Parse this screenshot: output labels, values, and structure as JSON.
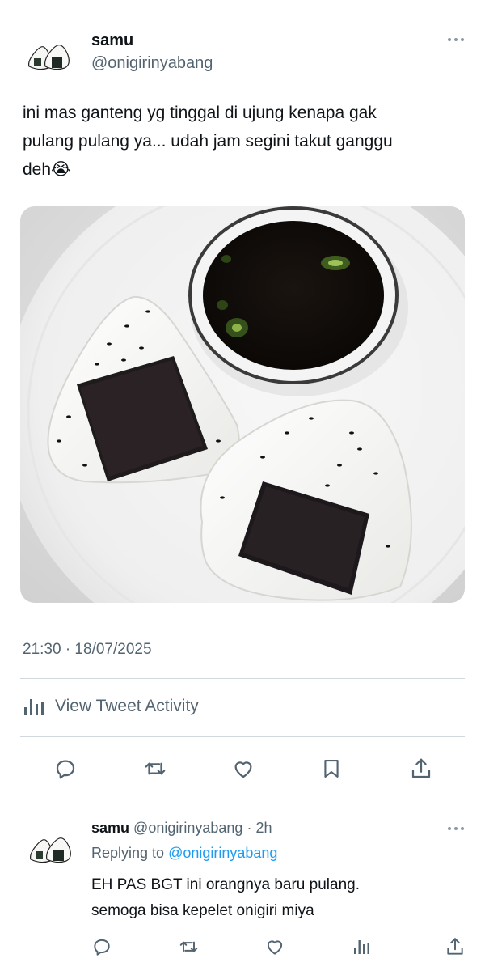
{
  "main_tweet": {
    "display_name": "samu",
    "handle": "@onigirinyabang",
    "text_line1": "ini mas ganteng yg tinggal di ujung kenapa gak",
    "text_line2": "pulang pulang ya... udah jam segini takut ganggu",
    "text_line3": "deh😭",
    "timestamp": "21:30 · 18/07/2025",
    "activity_label": "View Tweet Activity"
  },
  "icons": {
    "avatar": "onigiri-avatar-icon",
    "more": "more-dots-icon",
    "activity": "bar-chart-icon",
    "reply": "comment-bubble-icon",
    "retweet": "retweet-icon",
    "like": "heart-icon",
    "bookmark": "bookmark-icon",
    "share": "share-icon",
    "views": "views-icon"
  },
  "photo": {
    "subject": "two onigiri with nori and sesame beside a bowl of soy sauce with chili slices on a white plate"
  },
  "reply_tweet": {
    "display_name": "samu",
    "handle": "@onigirinyabang",
    "separator": "·",
    "age": "2h",
    "replying_prefix": "Replying to",
    "replying_handle": "@onigirinyabang",
    "text_line1": "EH PAS BGT ini orangnya baru pulang.",
    "text_line2": "semoga bisa kepelet onigiri miya"
  },
  "colors": {
    "text_primary": "#0f1419",
    "text_secondary": "#536471",
    "link": "#1d9bf0",
    "divider": "#cfd9de"
  }
}
